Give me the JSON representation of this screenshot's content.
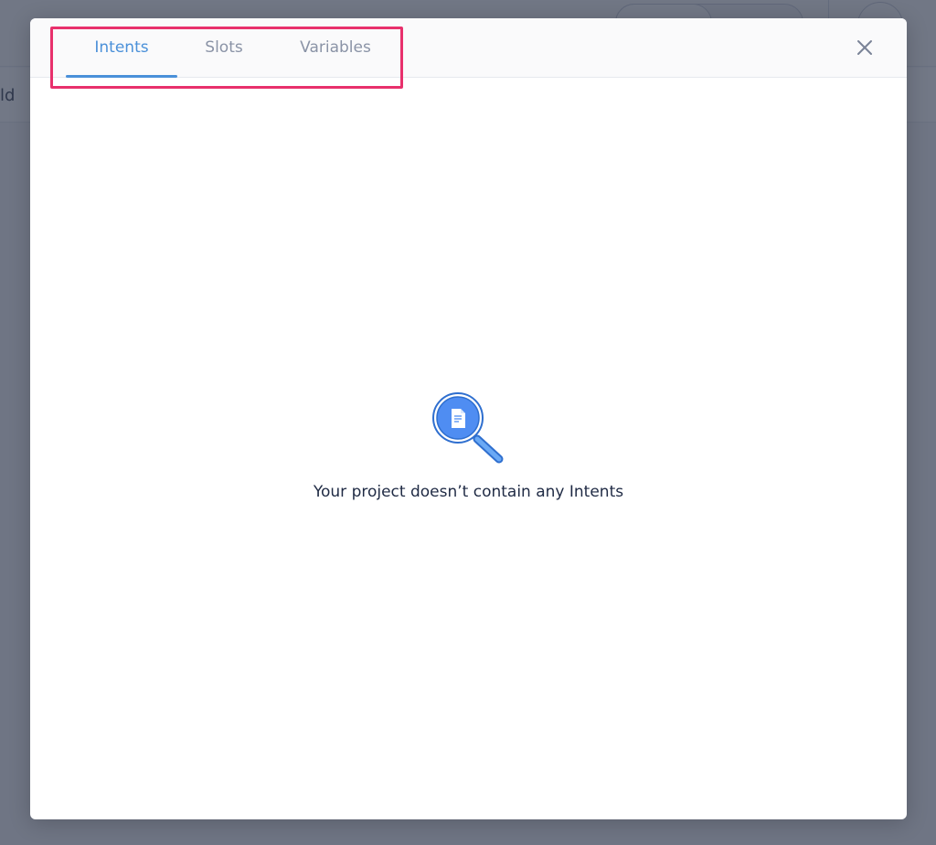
{
  "background": {
    "subbar_text": "ld"
  },
  "modal": {
    "tabs": [
      {
        "label": "Intents",
        "active": true
      },
      {
        "label": "Slots",
        "active": false
      },
      {
        "label": "Variables",
        "active": false
      }
    ],
    "close_icon": "close-icon",
    "empty_state": {
      "icon": "search-document-icon",
      "message": "Your project doesn’t contain any Intents"
    }
  },
  "colors": {
    "accent": "#4a90d9",
    "tab_inactive": "#8a93a6",
    "highlight": "#e8306c",
    "overlay": "#717a8c"
  }
}
